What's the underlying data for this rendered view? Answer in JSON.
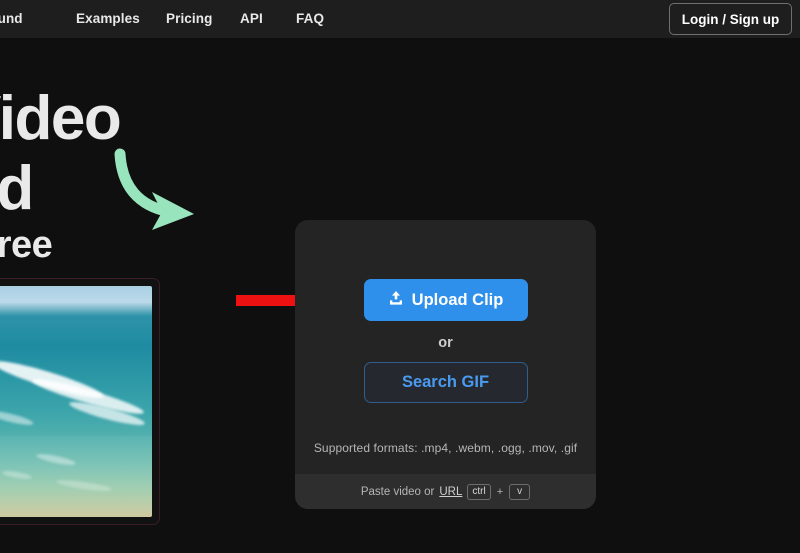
{
  "navbar": {
    "links": [
      {
        "label": "...ground",
        "name": "nav-link-remove-background"
      },
      {
        "label": "Examples",
        "name": "nav-link-examples"
      },
      {
        "label": "Pricing",
        "name": "nav-link-pricing"
      },
      {
        "label": "API",
        "name": "nav-link-api"
      },
      {
        "label": "FAQ",
        "name": "nav-link-faq"
      }
    ],
    "login_label": "Login / Sign up"
  },
  "hero": {
    "line1": "Video",
    "line2": "nd",
    "line3": "Free",
    "underline_color": "#98e5bd"
  },
  "annotations": {
    "green_arrow_color": "#98e5bd",
    "red_arrow_color": "#ee1111"
  },
  "thumbnail": {
    "alt": "aerial ocean beach clip",
    "border_color": "#3a1d26"
  },
  "upload_card": {
    "upload_label": "Upload Clip",
    "upload_icon": "upload-icon",
    "upload_color": "#2e90ea",
    "or_label": "or",
    "search_gif_label": "Search GIF",
    "search_gif_color": "#4a9bf0",
    "formats_label": "Supported formats: .mp4, .webm, .ogg, .mov, .gif",
    "footer": {
      "paste_label": "Paste video or",
      "url_label": "URL",
      "key_ctrl": "ctrl",
      "key_plus": "+",
      "key_v": "v"
    }
  }
}
